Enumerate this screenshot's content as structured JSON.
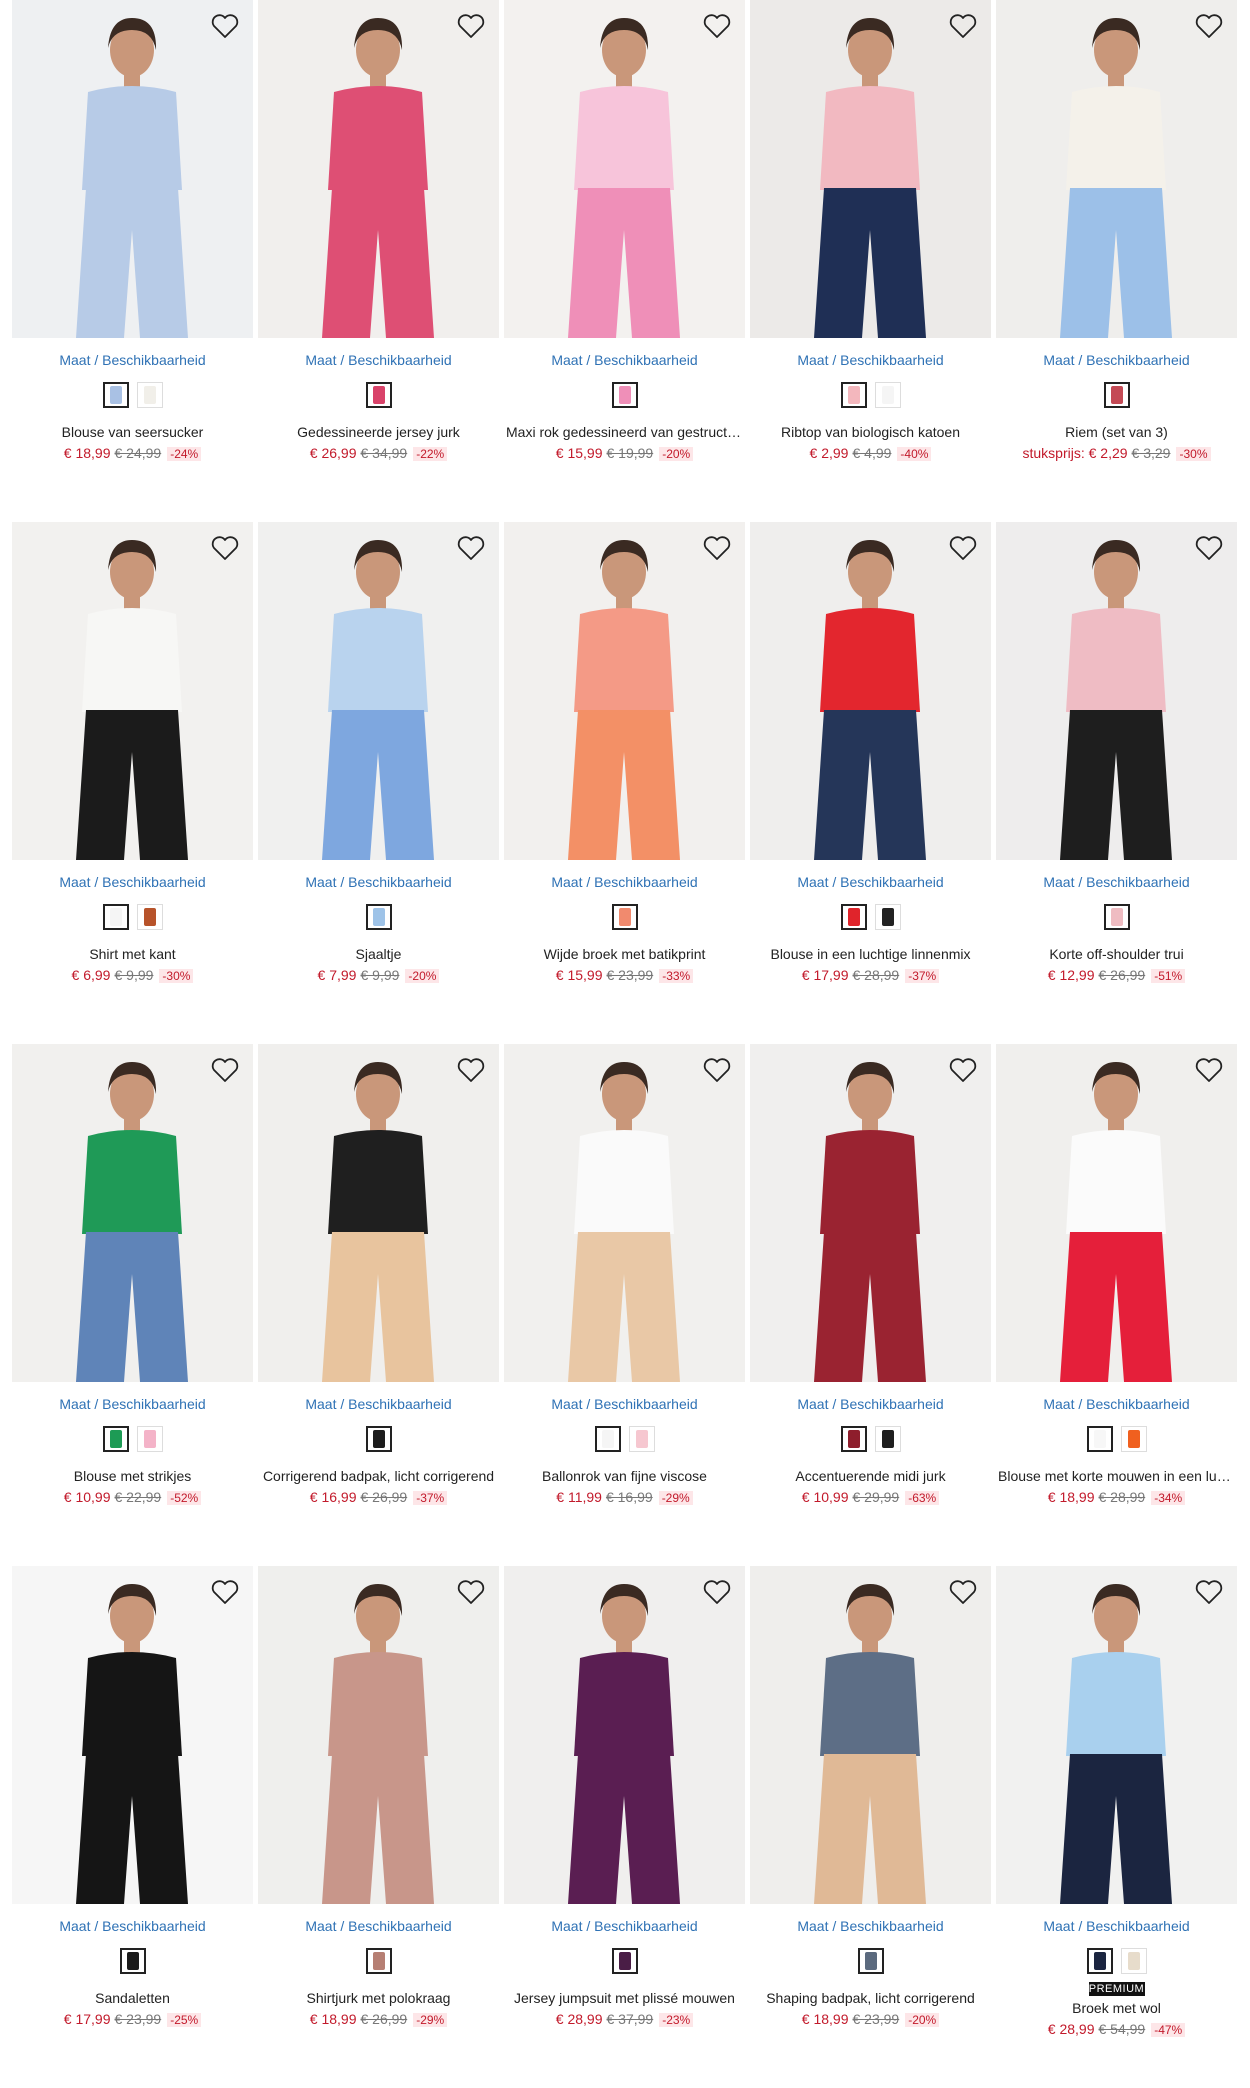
{
  "size_link": {
    "maat": "Maat",
    "sep": "/",
    "beschikbaarheid": "Beschikbaarheid"
  },
  "products": [
    {
      "name": "Blouse van seersucker",
      "prefix": "",
      "price": "€ 18,99",
      "old": "€ 24,99",
      "disc": "-24%",
      "colors": [
        "#a9c1e4",
        "#f1efe9"
      ],
      "badge": "",
      "photo": "#eef0f2",
      "garment": "#b7cbe7",
      "bottom": "#b7cbe7"
    },
    {
      "name": "Gedessineerde jersey jurk",
      "prefix": "",
      "price": "€ 26,99",
      "old": "€ 34,99",
      "disc": "-22%",
      "colors": [
        "#d9436a"
      ],
      "badge": "",
      "photo": "#f1efed",
      "garment": "#de4f74",
      "bottom": "#de4f74"
    },
    {
      "name": "Maxi rok gedessineerd van gestructureerd",
      "prefix": "",
      "price": "€ 15,99",
      "old": "€ 19,99",
      "disc": "-20%",
      "colors": [
        "#ef8fb8"
      ],
      "badge": "",
      "photo": "#f3f1ef",
      "garment": "#f7c4da",
      "bottom": "#ef8fb8"
    },
    {
      "name": "Ribtop van biologisch katoen",
      "prefix": "",
      "price": "€ 2,99",
      "old": "€ 4,99",
      "disc": "-40%",
      "colors": [
        "#f3b7bd",
        "#f5f5f5"
      ],
      "badge": "",
      "photo": "#eceae8",
      "garment": "#f2b9c1",
      "bottom": "#1f2f55"
    },
    {
      "name": "Riem (set van 3)",
      "prefix": "stuksprijs:",
      "price": "€ 2,29",
      "old": "€ 3,29",
      "disc": "-30%",
      "colors": [
        "#c44a55"
      ],
      "badge": "",
      "photo": "#efeeec",
      "garment": "#f4f1ea",
      "bottom": "#9cc0e8"
    },
    {
      "name": "Shirt met kant",
      "prefix": "",
      "price": "€ 6,99",
      "old": "€ 9,99",
      "disc": "-30%",
      "colors": [
        "#f5f5f5",
        "#b7532a"
      ],
      "badge": "",
      "photo": "#f2f1ef",
      "garment": "#f7f7f5",
      "bottom": "#1b1b1b"
    },
    {
      "name": "Sjaaltje",
      "prefix": "",
      "price": "€ 7,99",
      "old": "€ 9,99",
      "disc": "-20%",
      "colors": [
        "#9ec3e8"
      ],
      "badge": "",
      "photo": "#f0f0ef",
      "garment": "#b9d3ee",
      "bottom": "#7ea7df"
    },
    {
      "name": "Wijde broek met batikprint",
      "prefix": "",
      "price": "€ 15,99",
      "old": "€ 23,99",
      "disc": "-33%",
      "colors": [
        "#f18a6e"
      ],
      "badge": "",
      "photo": "#f2f0ee",
      "garment": "#f49a86",
      "bottom": "#f39066"
    },
    {
      "name": "Blouse in een luchtige linnenmix",
      "prefix": "",
      "price": "€ 17,99",
      "old": "€ 28,99",
      "disc": "-37%",
      "colors": [
        "#e0242b",
        "#222222"
      ],
      "badge": "",
      "photo": "#efeeed",
      "garment": "#e3262e",
      "bottom": "#253659"
    },
    {
      "name": "Korte off-shoulder trui",
      "prefix": "",
      "price": "€ 12,99",
      "old": "€ 26,99",
      "disc": "-51%",
      "colors": [
        "#efbcc2"
      ],
      "badge": "",
      "photo": "#eeeded",
      "garment": "#efbcc4",
      "bottom": "#1e1e1e"
    },
    {
      "name": "Blouse met strikjes",
      "prefix": "",
      "price": "€ 10,99",
      "old": "€ 22,99",
      "disc": "-52%",
      "colors": [
        "#1d9b55",
        "#f4b3c8"
      ],
      "badge": "",
      "photo": "#f1f0ee",
      "garment": "#1f9a57",
      "bottom": "#5f84b8"
    },
    {
      "name": "Corrigerend badpak, licht corrigerend",
      "prefix": "",
      "price": "€ 16,99",
      "old": "€ 26,99",
      "disc": "-37%",
      "colors": [
        "#1c1c1c"
      ],
      "badge": "",
      "photo": "#f0efed",
      "garment": "#1f1f1f",
      "bottom": "#e8c49e"
    },
    {
      "name": "Ballonrok van fijne viscose",
      "prefix": "",
      "price": "€ 11,99",
      "old": "€ 16,99",
      "disc": "-29%",
      "colors": [
        "#f5f5f5",
        "#f6c7d0"
      ],
      "badge": "",
      "photo": "#f1f0ee",
      "garment": "#fafafa",
      "bottom": "#e9c8a6"
    },
    {
      "name": "Accentuerende midi jurk",
      "prefix": "",
      "price": "€ 10,99",
      "old": "€ 29,99",
      "disc": "-63%",
      "colors": [
        "#8e1e2c",
        "#1e1e1e"
      ],
      "badge": "",
      "photo": "#f0efee",
      "garment": "#9a2331",
      "bottom": "#9a2331"
    },
    {
      "name": "Blouse met korte mouwen in een luchtige",
      "prefix": "",
      "price": "€ 18,99",
      "old": "€ 28,99",
      "disc": "-34%",
      "colors": [
        "#f7f7f7",
        "#f0601f"
      ],
      "badge": "",
      "photo": "#f0efed",
      "garment": "#fbfbfb",
      "bottom": "#e51f3a"
    },
    {
      "name": "Sandaletten",
      "prefix": "",
      "price": "€ 17,99",
      "old": "€ 23,99",
      "disc": "-25%",
      "colors": [
        "#1a1a1a"
      ],
      "badge": "",
      "photo": "#f6f6f6",
      "garment": "#151515",
      "bottom": "#151515"
    },
    {
      "name": "Shirtjurk met polokraag",
      "prefix": "",
      "price": "€ 18,99",
      "old": "€ 26,99",
      "disc": "-29%",
      "colors": [
        "#b67f73"
      ],
      "badge": "",
      "photo": "#efefed",
      "garment": "#c8968a",
      "bottom": "#c8968a"
    },
    {
      "name": "Jersey jumpsuit met plissé mouwen",
      "prefix": "",
      "price": "€ 28,99",
      "old": "€ 37,99",
      "disc": "-23%",
      "colors": [
        "#4a1d46"
      ],
      "badge": "",
      "photo": "#f0efee",
      "garment": "#5a1e52",
      "bottom": "#5a1e52"
    },
    {
      "name": "Shaping badpak, licht corrigerend",
      "prefix": "",
      "price": "€ 18,99",
      "old": "€ 23,99",
      "disc": "-20%",
      "colors": [
        "#5b6a7e"
      ],
      "badge": "",
      "photo": "#efeeec",
      "garment": "#5d6e86",
      "bottom": "#e0b996"
    },
    {
      "name": "Broek met wol",
      "prefix": "",
      "price": "€ 28,99",
      "old": "€ 54,99",
      "disc": "-47%",
      "colors": [
        "#1b2540",
        "#e7dccb"
      ],
      "badge": "PREMIUM",
      "photo": "#f1f1f0",
      "garment": "#a9d0ee",
      "bottom": "#1b2540"
    }
  ]
}
